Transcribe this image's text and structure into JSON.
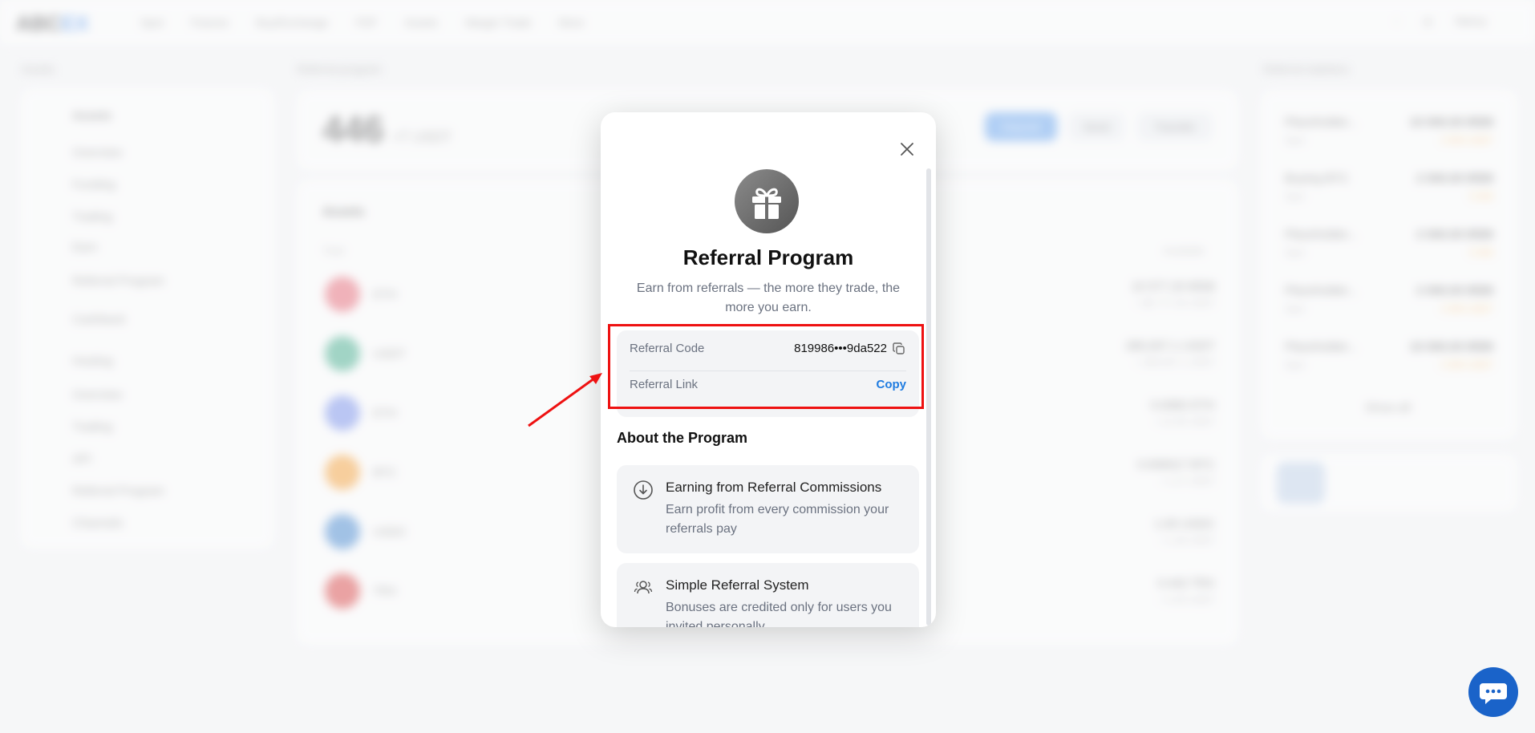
{
  "background": {
    "logo_main": "ABCEX",
    "nav": [
      "Spot",
      "Futures",
      "Buy/Exchange",
      "P2P",
      "Assets",
      "Margin Trade",
      "More"
    ],
    "user": "Nancy",
    "crumb_left": "Assets",
    "crumb_mid": "Referral program",
    "crumb_right": "Referral statistics",
    "side_items": [
      "Assets",
      "Overview",
      "Funding",
      "Trading",
      "Earn",
      "Referral Program",
      "Cashback",
      "Hosting",
      "Overview",
      "Trading",
      "API",
      "Referral Program",
      "Channels"
    ],
    "balance_value": "446",
    "balance_unit": "≈T USDT",
    "buttons": [
      "Deposit",
      "Send",
      "Transfer"
    ],
    "assets_title": "Assets",
    "assets_col_left": "Total",
    "assets_col_right": "Available",
    "assets": [
      {
        "name": "ETH",
        "value": "10 577.20 8558",
        "sub": "≈ $0 777.44 USDT",
        "color": "#e55060"
      },
      {
        "name": "USDT",
        "value": "280,007.1 USDT",
        "sub": "≈ 280,007.1 USDT",
        "color": "#26a17b"
      },
      {
        "name": "ETH",
        "value": "0.0082 ETH",
        "sub": "≈ 22.45 USDT",
        "color": "#627eea"
      },
      {
        "name": "BTC",
        "value": "0.000017 BTC",
        "sub": "≈ 1.27 USDT",
        "color": "#f7931a"
      },
      {
        "name": "USDC",
        "value": "1.00 USDC",
        "sub": "≈ 1.00 USDT",
        "color": "#2775ca"
      },
      {
        "name": "TRX",
        "value": "0.442 TRX",
        "sub": "≈ 0.03 USDT",
        "color": "#d62828"
      }
    ],
    "rank": [
      {
        "a": "Placeholder...",
        "b": "10 000.00 8558",
        "c": "Spot",
        "d": "2 500 USDT"
      },
      {
        "a": "Buying BTC",
        "b": "2 000.00 8558",
        "c": "Spot",
        "d": "5 000"
      },
      {
        "a": "Placeholder...",
        "b": "2 000.00 8558",
        "c": "Spot",
        "d": "5 000"
      },
      {
        "a": "Placeholder...",
        "b": "2 000.00 8558",
        "c": "Spot",
        "d": "2 500 USDT"
      },
      {
        "a": "Placeholder...",
        "b": "10 000.00 8558",
        "c": "Spot",
        "d": "2 500 USDT"
      }
    ],
    "show_all": "Show all"
  },
  "modal": {
    "title": "Referral Program",
    "description": "Earn from referrals — the more they trade, the more you earn.",
    "referral_code_label": "Referral Code",
    "referral_code_value": "819986•••9da522",
    "referral_link_label": "Referral Link",
    "referral_link_action": "Copy",
    "about_title": "About the Program",
    "cards": [
      {
        "title": "Earning from Referral Commissions",
        "text": "Earn profit from every commission your referrals pay"
      },
      {
        "title": "Simple Referral System",
        "text": "Bonuses are credited only for users you invited personally"
      }
    ]
  },
  "colors": {
    "accent": "#1e7be0",
    "highlight": "#e11111",
    "chat": "#1a63c9"
  }
}
